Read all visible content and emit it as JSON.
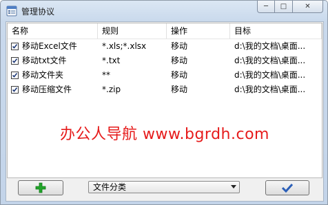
{
  "window": {
    "title": "管理协议"
  },
  "caption": {
    "minimize": "─",
    "maximize": "□",
    "close": "✕"
  },
  "table": {
    "columns": [
      "名称",
      "规则",
      "操作",
      "目标"
    ],
    "rows": [
      {
        "checked": true,
        "name": "移动Excel文件",
        "rule": "*.xls;*.xlsx",
        "action": "移动",
        "target": "d:\\我的文档\\桌面..."
      },
      {
        "checked": true,
        "name": "移动txt文件",
        "rule": "*.txt",
        "action": "移动",
        "target": "d:\\我的文档\\桌面..."
      },
      {
        "checked": true,
        "name": "移动文件夹",
        "rule": "**",
        "action": "移动",
        "target": "d:\\我的文档\\桌面..."
      },
      {
        "checked": true,
        "name": "移动压缩文件",
        "rule": "*.zip",
        "action": "移动",
        "target": "d:\\我的文档\\桌面..."
      }
    ]
  },
  "watermark": "办公人导航 www.bgrdh.com",
  "toolbar": {
    "add_icon": "plus-icon",
    "category_selected": "文件分类",
    "ok_icon": "checkmark-icon"
  },
  "colors": {
    "add_green": "#22a52a",
    "ok_blue": "#2b5fb8",
    "watermark_red": "#e61b1b"
  }
}
